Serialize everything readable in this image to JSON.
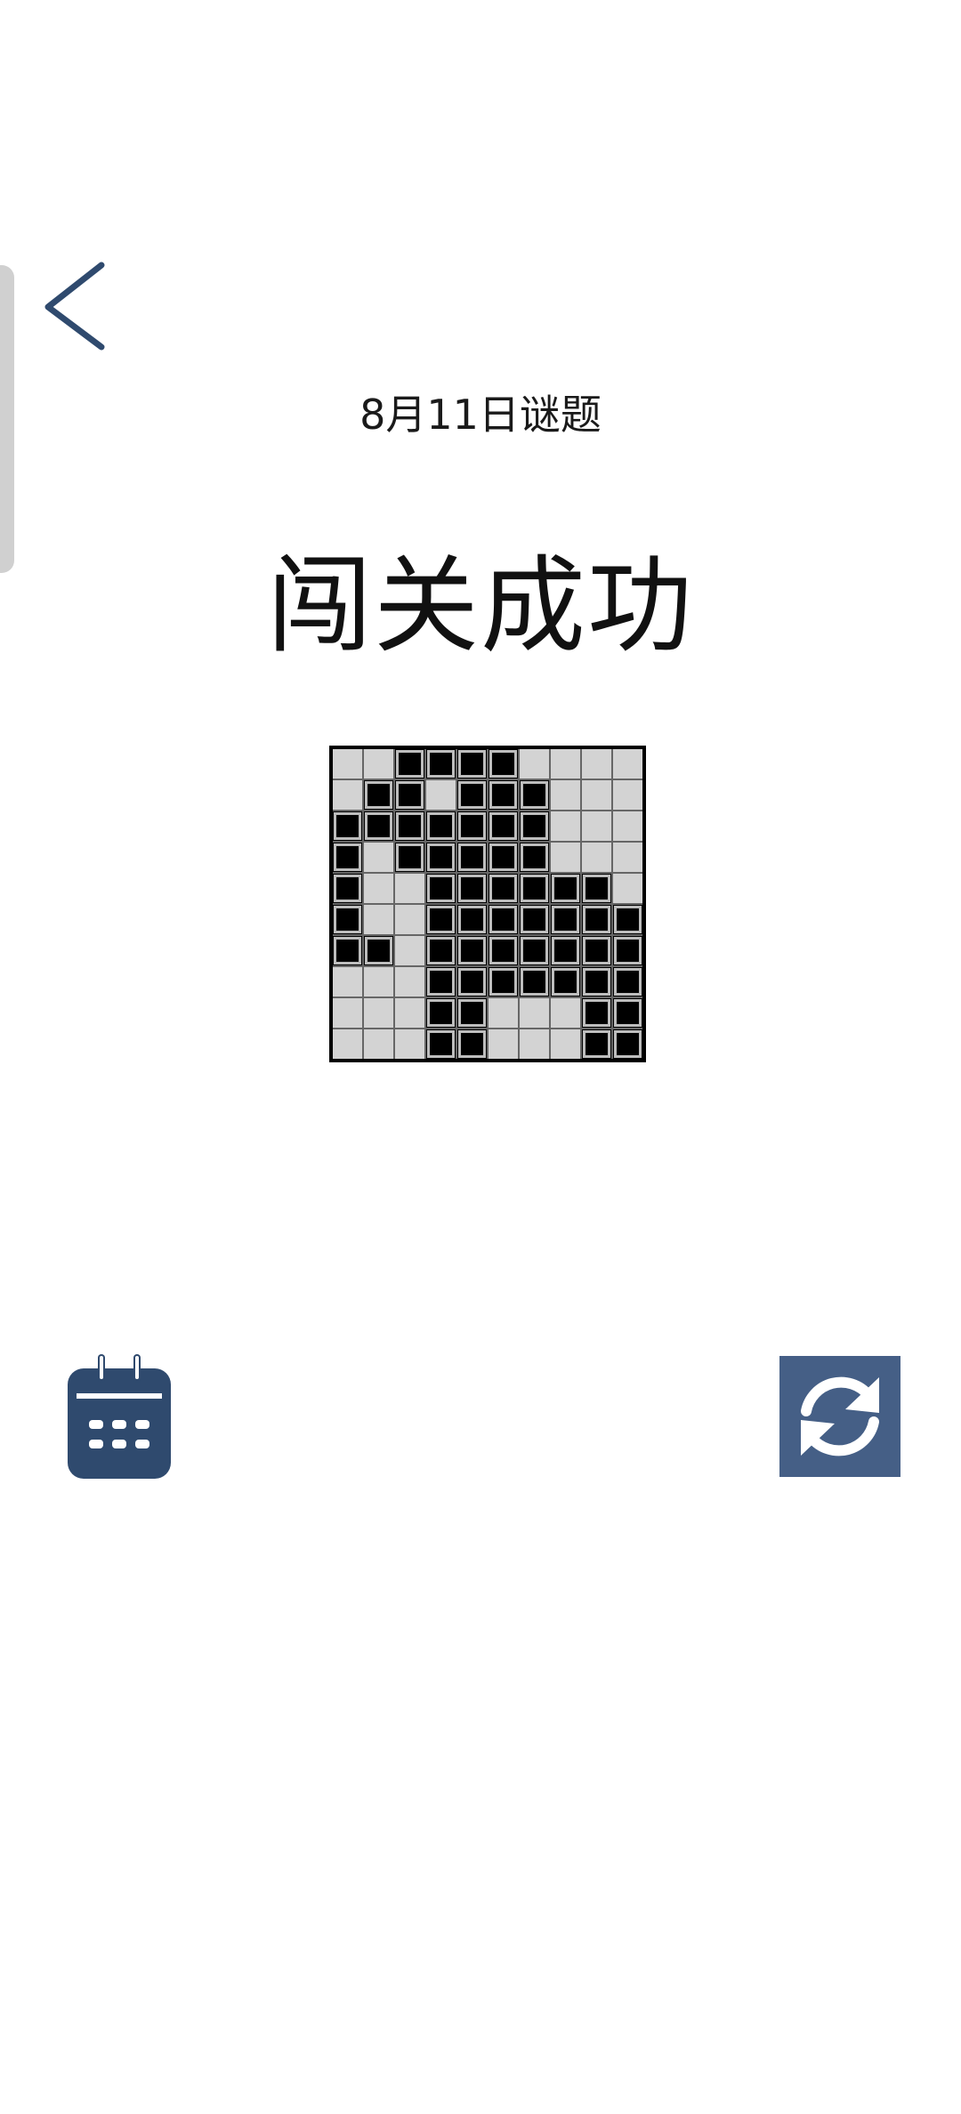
{
  "header": {
    "back_icon": "chevron-left-icon",
    "date_title": "8月11日谜题",
    "success_text": "闯关成功"
  },
  "puzzle": {
    "rows": 10,
    "cols": 10,
    "grid": [
      [
        0,
        0,
        1,
        1,
        1,
        1,
        0,
        0,
        0,
        0
      ],
      [
        0,
        1,
        1,
        0,
        1,
        1,
        1,
        0,
        0,
        0
      ],
      [
        1,
        1,
        1,
        1,
        1,
        1,
        1,
        0,
        0,
        0
      ],
      [
        1,
        0,
        1,
        1,
        1,
        1,
        1,
        0,
        0,
        0
      ],
      [
        1,
        0,
        0,
        1,
        1,
        1,
        1,
        1,
        1,
        0
      ],
      [
        1,
        0,
        0,
        1,
        1,
        1,
        1,
        1,
        1,
        1
      ],
      [
        1,
        1,
        0,
        1,
        1,
        1,
        1,
        1,
        1,
        1
      ],
      [
        0,
        0,
        0,
        1,
        1,
        1,
        1,
        1,
        1,
        1
      ],
      [
        0,
        0,
        0,
        1,
        1,
        0,
        0,
        0,
        1,
        1
      ],
      [
        0,
        0,
        0,
        1,
        1,
        0,
        0,
        0,
        1,
        1
      ]
    ],
    "filled_color": "#000000",
    "empty_color": "#d3d3d3"
  },
  "actions": {
    "calendar_icon": "calendar-icon",
    "refresh_icon": "refresh-icon",
    "accent_color": "#2f4a6e",
    "refresh_bg_color": "#455f86"
  }
}
